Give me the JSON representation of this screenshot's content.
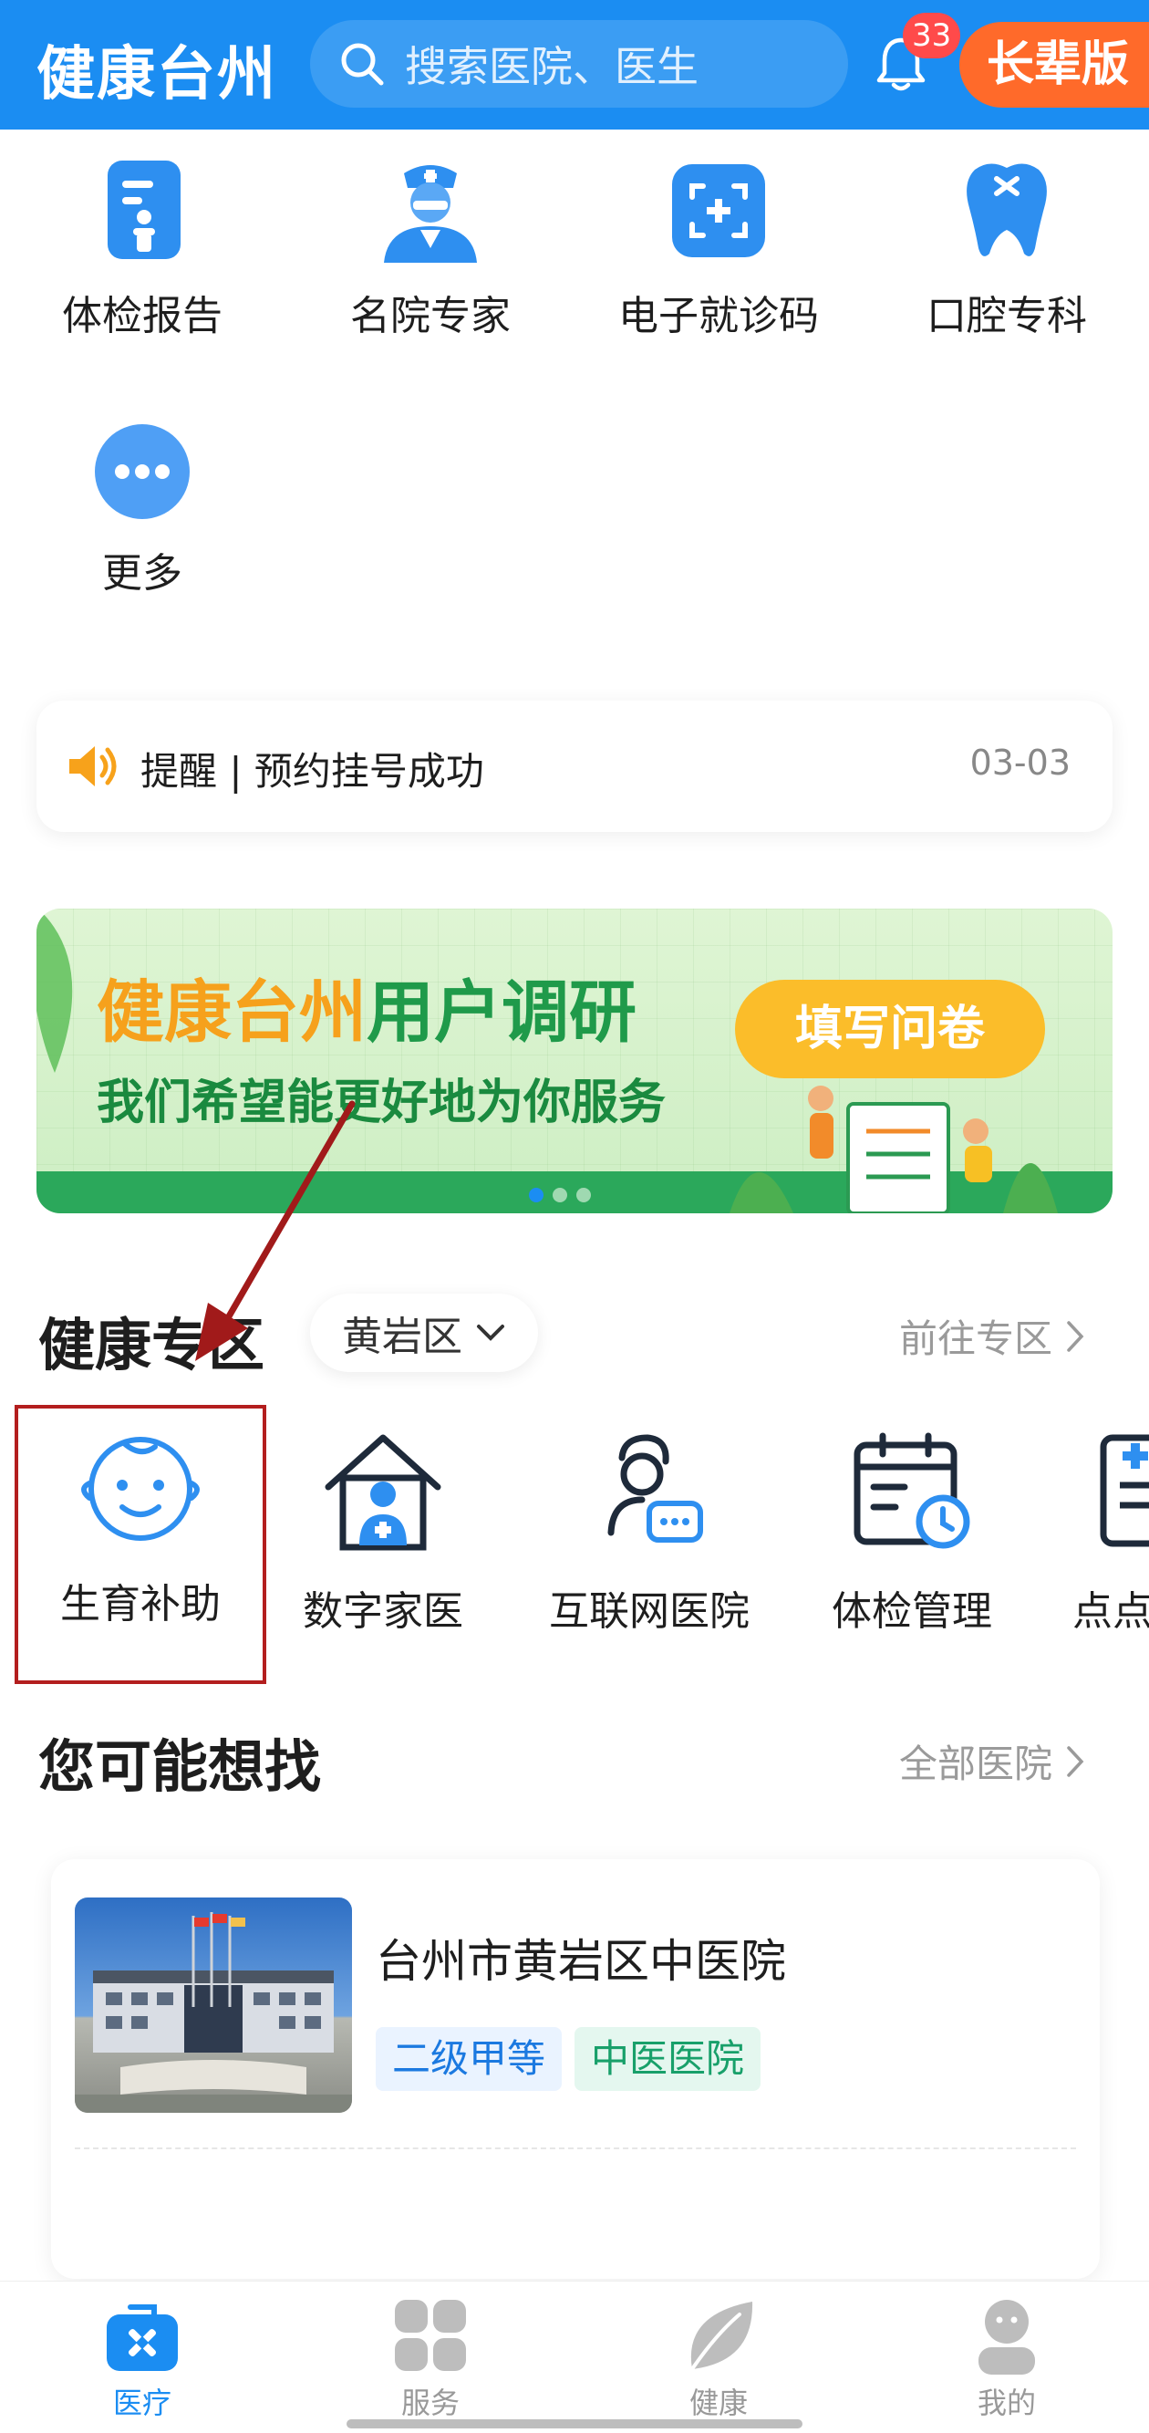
{
  "header": {
    "brand": "健康台州",
    "search_placeholder": "搜索医院、医生",
    "notification_count": "33",
    "elder_mode": "长辈版"
  },
  "quick_services": [
    {
      "label": "体检报告",
      "icon": "report-icon"
    },
    {
      "label": "名院专家",
      "icon": "doctor-icon"
    },
    {
      "label": "电子就诊码",
      "icon": "scan-code-icon"
    },
    {
      "label": "口腔专科",
      "icon": "tooth-icon"
    },
    {
      "label": "更多",
      "icon": "more-icon"
    }
  ],
  "notice": {
    "text": "提醒 | 预约挂号成功",
    "date": "03-03"
  },
  "banner": {
    "title_part1": "健康台州",
    "title_part2": "用户调研",
    "subtitle": "我们希望能更好地为你服务",
    "button": "填写问卷"
  },
  "health_zone": {
    "title": "健康专区",
    "region": "黄岩区",
    "more": "前往专区",
    "items": [
      {
        "label": "生育补助",
        "icon": "baby-face-icon"
      },
      {
        "label": "数字家医",
        "icon": "home-doctor-icon"
      },
      {
        "label": "互联网医院",
        "icon": "online-doctor-icon"
      },
      {
        "label": "体检管理",
        "icon": "calendar-clock-icon"
      },
      {
        "label": "点点",
        "icon": "document-icon"
      }
    ]
  },
  "suggest": {
    "title": "您可能想找",
    "more": "全部医院",
    "hospital": {
      "name": "台州市黄岩区中医院",
      "tags": [
        "二级甲等",
        "中医医院"
      ]
    }
  },
  "bottom_nav": [
    {
      "label": "医疗",
      "icon": "medical-kit-icon",
      "active": true
    },
    {
      "label": "服务",
      "icon": "grid-icon",
      "active": false
    },
    {
      "label": "健康",
      "icon": "leaf-icon",
      "active": false
    },
    {
      "label": "我的",
      "icon": "user-icon",
      "active": false
    }
  ],
  "colors": {
    "primary": "#1b8df2",
    "elder_button": "#ff6a2a",
    "highlight_red": "#b31e1e"
  }
}
